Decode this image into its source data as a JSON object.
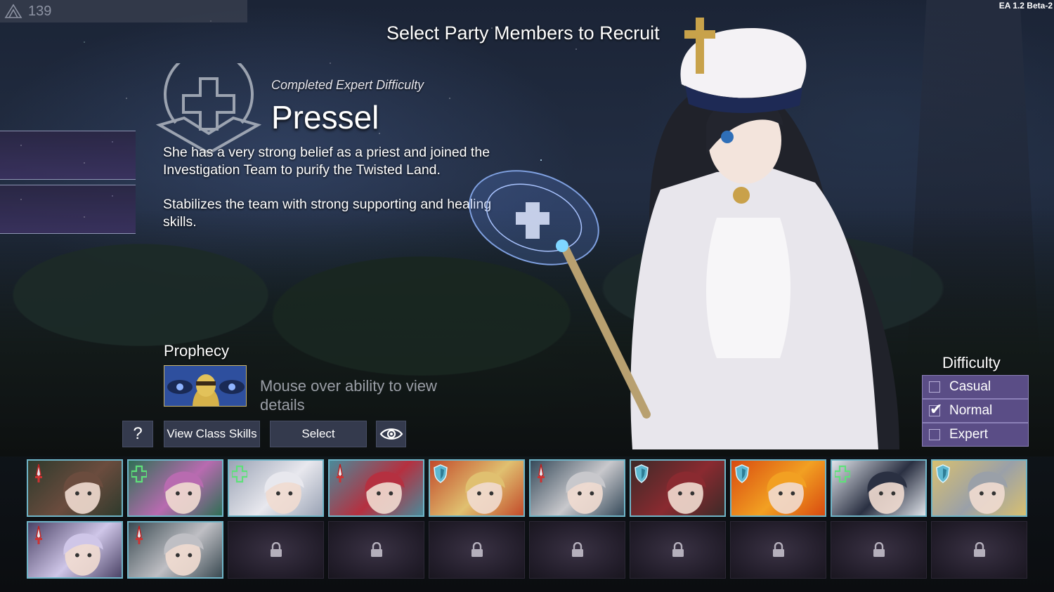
{
  "counter": {
    "value": "139"
  },
  "version": "EA 1.2 Beta-2",
  "title": "Select Party Members to Recruit",
  "character": {
    "completed": "Completed Expert Difficulty",
    "name": "Pressel",
    "description_1": "She has a very strong belief as a priest and joined the Investigation Team to purify the Twisted Land.",
    "description_2": "Stabilizes the team with strong supporting and healing skills."
  },
  "prophecy": {
    "label": "Prophecy",
    "hint": "Mouse over ability to view details"
  },
  "buttons": {
    "help": "?",
    "view_class_skills": "View Class Skills",
    "select": "Select"
  },
  "difficulty": {
    "label": "Difficulty",
    "options": [
      {
        "label": "Casual",
        "checked": false
      },
      {
        "label": "Normal",
        "checked": true
      },
      {
        "label": "Expert",
        "checked": false
      }
    ]
  },
  "roster": [
    {
      "class": "sword",
      "palette": [
        "#6b4c3e",
        "#2e3a2c"
      ]
    },
    {
      "class": "heal",
      "palette": [
        "#b86bb0",
        "#2f6e55"
      ]
    },
    {
      "class": "heal",
      "palette": [
        "#e8e8ee",
        "#9aa3b5"
      ]
    },
    {
      "class": "sword",
      "palette": [
        "#b53040",
        "#4a8a9a"
      ]
    },
    {
      "class": "shield",
      "palette": [
        "#e0c070",
        "#c24a2a"
      ]
    },
    {
      "class": "sword",
      "palette": [
        "#c8c8cc",
        "#364a5a"
      ]
    },
    {
      "class": "shield",
      "palette": [
        "#8a2a30",
        "#3c2a28"
      ]
    },
    {
      "class": "shield",
      "palette": [
        "#f2a022",
        "#d84a10"
      ]
    },
    {
      "class": "heal",
      "palette": [
        "#2a3042",
        "#e0e4ea"
      ]
    },
    {
      "class": "shield",
      "palette": [
        "#9aa0a8",
        "#d8c070"
      ]
    },
    {
      "class": "sword",
      "palette": [
        "#cfc6e8",
        "#4b4366"
      ]
    },
    {
      "class": "sword",
      "palette": [
        "#bfbfc4",
        "#3a4a52"
      ]
    },
    {
      "class": "locked"
    },
    {
      "class": "locked"
    },
    {
      "class": "locked"
    },
    {
      "class": "locked"
    },
    {
      "class": "locked"
    },
    {
      "class": "locked"
    },
    {
      "class": "locked"
    },
    {
      "class": "locked"
    }
  ],
  "colors": {
    "difficulty_bg": "#5a4d86",
    "hero_border": "#6fb5c8",
    "button_bg": "#343a4d"
  }
}
